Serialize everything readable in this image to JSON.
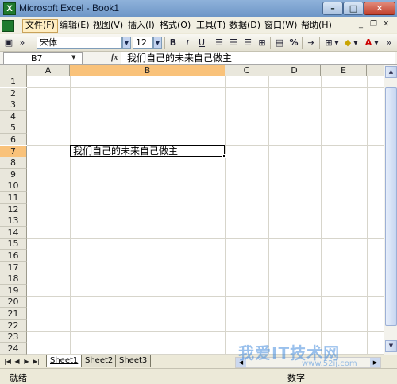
{
  "window": {
    "title": "Microsoft Excel - Book1",
    "app_icon": "excel-icon"
  },
  "menubar": {
    "items": [
      {
        "label": "文件(F)"
      },
      {
        "label": "编辑(E)"
      },
      {
        "label": "视图(V)"
      },
      {
        "label": "插入(I)"
      },
      {
        "label": "格式(O)"
      },
      {
        "label": "工具(T)"
      },
      {
        "label": "数据(D)"
      },
      {
        "label": "窗口(W)"
      },
      {
        "label": "帮助(H)"
      }
    ],
    "active_index": 0
  },
  "toolbar": {
    "font_name": "宋体",
    "font_size": "12",
    "bold_label": "B",
    "italic_label": "I",
    "underline_label": "U",
    "percent_label": "%"
  },
  "formula_bar": {
    "name_box": "B7",
    "fx_label": "fx",
    "content": "我们自己的未来自己做主"
  },
  "grid": {
    "columns": [
      "A",
      "B",
      "C",
      "D",
      "E"
    ],
    "selected_column": "B",
    "rows": [
      "1",
      "2",
      "3",
      "4",
      "5",
      "6",
      "7",
      "8",
      "9",
      "10",
      "11",
      "12",
      "13",
      "14",
      "15",
      "16",
      "17",
      "18",
      "19",
      "20",
      "21",
      "22",
      "23",
      "24"
    ],
    "selected_row": "7",
    "active_cell": {
      "ref": "B7",
      "value": "我们自己的未来自己做主"
    }
  },
  "sheet_tabs": [
    "Sheet1",
    "Sheet2",
    "Sheet3"
  ],
  "active_sheet": "Sheet1",
  "status_bar": {
    "left": "就绪",
    "right": "数字"
  },
  "watermark": {
    "main": "我爱IT技术网",
    "sub": "www.52ij.com"
  }
}
